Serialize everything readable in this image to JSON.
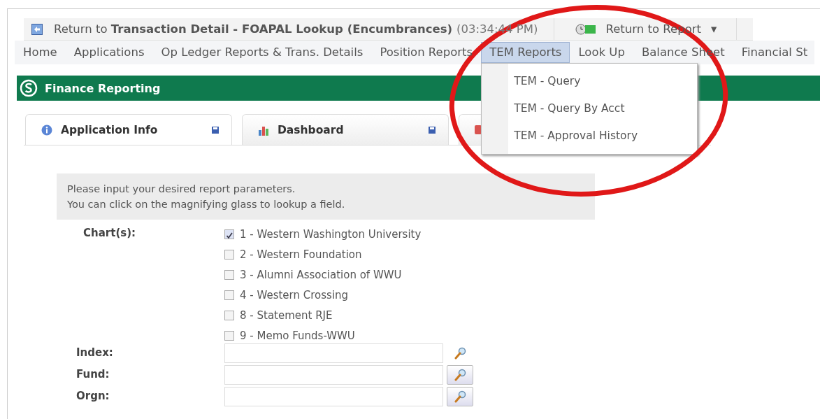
{
  "top_bar": {
    "return_link": "Return to **Transaction Detail - FOAPAL Lookup (Encumbrances)**",
    "time": "(03:34:44 PM)",
    "report_button": {
      "label": "Return to Report",
      "caret": "▾"
    }
  },
  "nav": {
    "items": [
      {
        "label": "Home",
        "selected": false
      },
      {
        "label": "Applications",
        "selected": false
      },
      {
        "label": "Op Ledger Reports & Trans. Details",
        "selected": false
      },
      {
        "label": "Position Reports",
        "selected": false
      },
      {
        "label": "TEM Reports",
        "selected": true,
        "menu": [
          "TEM - Query",
          "TEM - Query By Acct",
          "TEM - Approval History"
        ]
      },
      {
        "label": "Look Up",
        "selected": false
      },
      {
        "label": "Balance Sheet",
        "selected": false
      },
      {
        "label": "Financial St",
        "selected": false
      }
    ]
  },
  "banner": {
    "title": "Finance Reporting"
  },
  "tabs": [
    {
      "label": "Application Info",
      "kind": "info",
      "selected": true
    },
    {
      "label": "Dashboard",
      "kind": "chart",
      "selected": false
    },
    {
      "kind": "other",
      "selected": false
    }
  ],
  "form": {
    "instructions": [
      "Please input your desired report parameters.",
      "You can click on the magnifying glass to lookup a field."
    ],
    "charts_label": "Chart(s):",
    "charts": [
      {
        "label": "1 - Western Washington University",
        "checked": true
      },
      {
        "label": "2 - Western Foundation",
        "checked": false
      },
      {
        "label": "3 - Alumni Association of WWU",
        "checked": false
      },
      {
        "label": "4 - Western Crossing",
        "checked": false
      },
      {
        "label": "8 - Statement RJE",
        "checked": false
      },
      {
        "label": "9 - Memo Funds-WWU",
        "checked": false
      }
    ],
    "fields": [
      {
        "label": "Index:",
        "kind": "plain"
      },
      {
        "label": "Fund:",
        "kind": "button"
      },
      {
        "label": "Orgn:",
        "kind": "button"
      }
    ]
  },
  "annotation": {
    "kind": "circle"
  }
}
